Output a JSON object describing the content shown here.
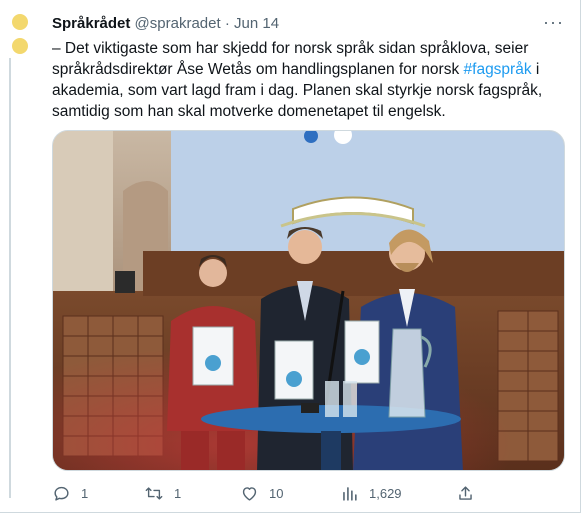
{
  "tweet": {
    "display_name": "Språkrådet",
    "handle": "@sprakradet",
    "separator": "·",
    "date": "Jun 14",
    "more_glyph": "···",
    "text_before": "– Det viktigaste som har skjedd for norsk språk sidan språklova, seier språkrådsdirektør Åse Wetås om handlingsplanen for norsk ",
    "hashtag": "#fagspråk",
    "text_after": " i akademia, som vart lagd fram i dag. Planen skal styrkje norsk fagspråk, samtidig som han skal motverke domenetapet til engelsk.",
    "avatar_color": "#f3d86e",
    "link_color": "#1d9bf0"
  },
  "actions": {
    "reply_icon": "reply-icon",
    "reply_count": "1",
    "retweet_icon": "retweet-icon",
    "retweet_count": "1",
    "like_icon": "heart-icon",
    "like_count": "10",
    "views_icon": "views-icon",
    "views_count": "1,629",
    "share_icon": "share-icon"
  }
}
